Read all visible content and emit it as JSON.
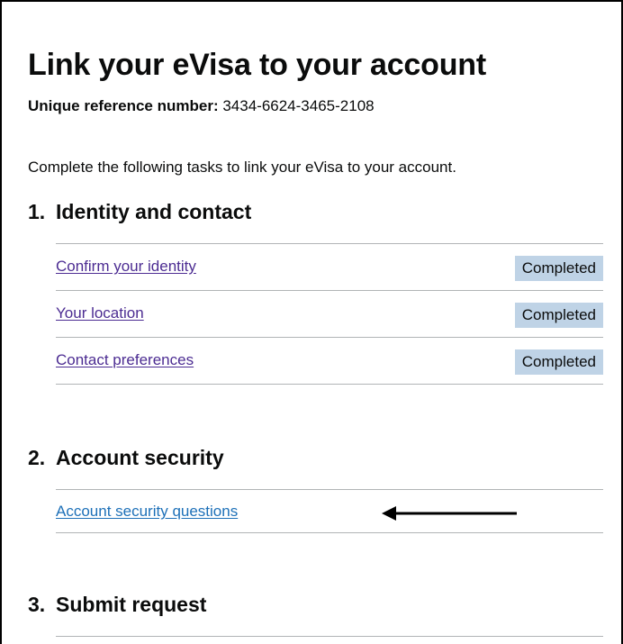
{
  "page": {
    "title": "Link your eVisa to your account",
    "reference_label": "Unique reference number:",
    "reference_value": "3434-6624-3465-2108",
    "intro": "Complete the following tasks to link your eVisa to your account."
  },
  "sections": [
    {
      "number": "1.",
      "heading": "Identity and contact",
      "tasks": [
        {
          "label": "Confirm your identity",
          "status": "Completed"
        },
        {
          "label": "Your location",
          "status": "Completed"
        },
        {
          "label": "Contact preferences",
          "status": "Completed"
        }
      ]
    },
    {
      "number": "2.",
      "heading": "Account security",
      "tasks": [
        {
          "label": "Account security questions",
          "status": ""
        }
      ]
    },
    {
      "number": "3.",
      "heading": "Submit request",
      "tasks": []
    }
  ],
  "colors": {
    "link_unvisited": "#1d70b8",
    "link_visited": "#4c2c92",
    "tag_background": "#bfd3e6",
    "divider": "#b1b4b6"
  },
  "icons": {
    "annotation": "left-arrow-icon"
  }
}
